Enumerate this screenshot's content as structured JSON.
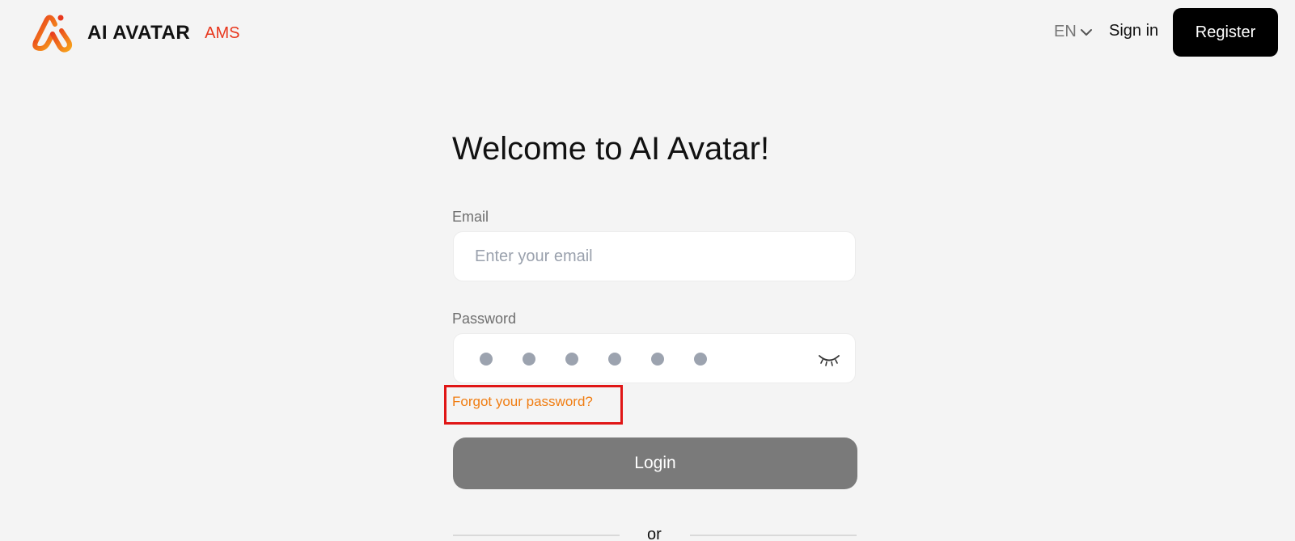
{
  "header": {
    "brand": "AI AVATAR",
    "brand_sub": "AMS",
    "language": "EN",
    "sign_in": "Sign in",
    "register": "Register"
  },
  "form": {
    "title": "Welcome to AI Avatar!",
    "email_label": "Email",
    "email_placeholder": "Enter your email",
    "email_value": "",
    "password_label": "Password",
    "password_masked_length": 6,
    "forgot_password": "Forgot your password?",
    "login": "Login",
    "divider": "or"
  },
  "colors": {
    "accent_orange": "#f07d12",
    "brand_red": "#e8371d",
    "highlight_box": "#e01616",
    "login_button": "#7a7a7a",
    "register_button": "#000000",
    "background": "#f4f4f4"
  },
  "icons": {
    "language_dropdown": "chevron-down-icon",
    "password_toggle": "eye-closed-icon",
    "logo": "ai-avatar-logo"
  }
}
